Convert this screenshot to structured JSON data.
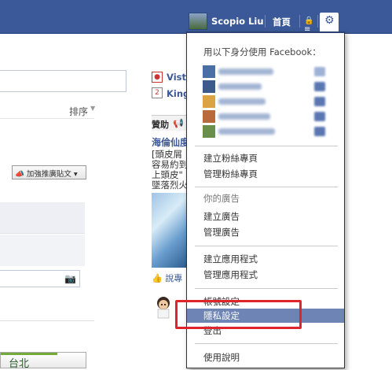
{
  "topbar": {
    "user_name": "Scopio Liu",
    "home_label": "首頁",
    "lock_icon": "lock-icon",
    "gear_icon": "gear-icon"
  },
  "left": {
    "sort_label": "排序",
    "promote_label": "加強推廣貼文",
    "city_label": "台北"
  },
  "middle": {
    "link1": "Vist",
    "link2": "King",
    "sponsor_label": "贊助",
    "ad_title": "海倫仙度",
    "ad_lines": [
      "[頭皮屑",
      "容易約到",
      "上頭皮\"",
      "墜落烈火"
    ],
    "like_label": "說專"
  },
  "menu": {
    "header": "用以下身分使用 Facebook：",
    "items": [
      {
        "label": "建立粉絲專頁"
      },
      {
        "label": "管理粉絲專頁"
      },
      {
        "label": "你的廣告"
      },
      {
        "label": "建立廣告"
      },
      {
        "label": "管理廣告"
      },
      {
        "label": "建立應用程式"
      },
      {
        "label": "管理應用程式"
      },
      {
        "label": "帳號設定"
      },
      {
        "label": "隱私設定"
      },
      {
        "label": "登出"
      },
      {
        "label": "使用說明"
      }
    ],
    "highlight_color": "#e0242c",
    "active_color": "#6d84b4"
  }
}
